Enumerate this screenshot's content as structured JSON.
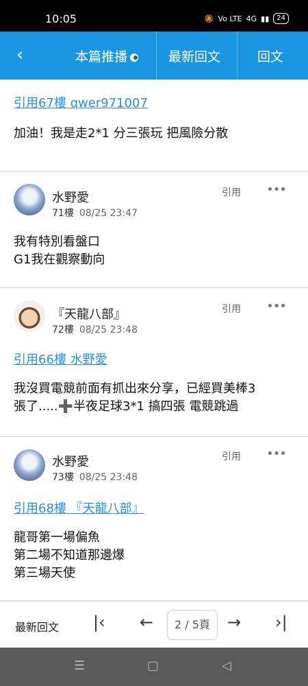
{
  "status": {
    "time": "10:05",
    "net1": "Vo LTE",
    "net2": "4G",
    "battery": "24"
  },
  "header": {
    "tab1": "本篇推播",
    "tab2": "最新回文",
    "tab3": "回文"
  },
  "posts": [
    {
      "quote": "引用67樓 qwer971007",
      "body": "加油！我是走2*1 分三張玩 把風險分散"
    },
    {
      "name": "水野愛",
      "floor": "71樓",
      "time": "08/25 23:47",
      "quote_btn": "引用",
      "body_line1": "我有特別看盤口",
      "body_line2": "G1我在觀察動向"
    },
    {
      "name": "『天龍八部』",
      "floor": "72樓",
      "time": "08/25 23:48",
      "quote_btn": "引用",
      "quote": "引用66樓 水野愛",
      "body_line1": "我沒買電競前面有抓出來分享，已經買美棒3",
      "body_line2": "張了.....➕半夜足球3*1 搞四張 電競跳過"
    },
    {
      "name": "水野愛",
      "floor": "73樓",
      "time": "08/25 23:48",
      "quote_btn": "引用",
      "quote": "引用68樓 『天龍八部』",
      "body_line1": "龍哥第一場偏魚",
      "body_line2": "第二場不知道那邊爆",
      "body_line3": "第三場天使"
    }
  ],
  "footer": {
    "latest": "最新回文",
    "page": "2 / 5頁"
  }
}
